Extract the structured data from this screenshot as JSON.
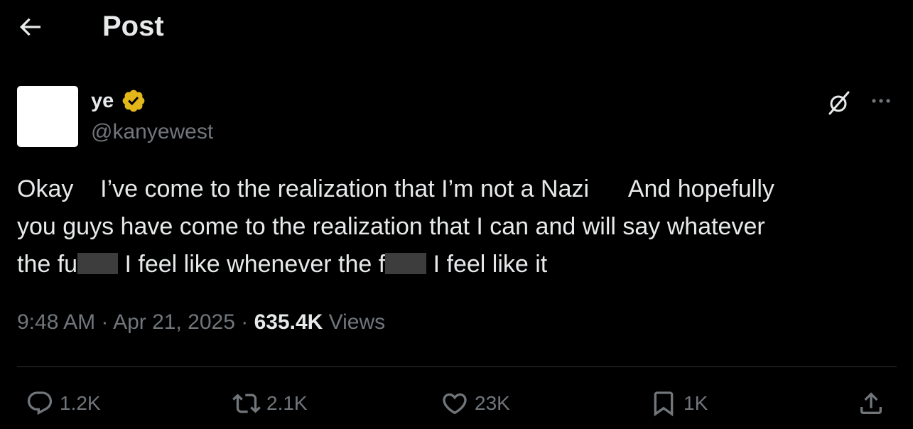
{
  "header": {
    "title": "Post"
  },
  "author": {
    "display_name": "ye",
    "handle": "@kanyewest",
    "verified": true
  },
  "post": {
    "line1": "Okay    I’ve come to the realization that I’m not a Nazi      And hopefully",
    "line2": "you guys have come to the realization that I can and will say whatever",
    "line3a": "the fu",
    "line3b": " I feel like whenever the f",
    "line3c": " I feel like it"
  },
  "meta": {
    "time": "9:48 AM",
    "sep1": " · ",
    "date": "Apr 21, 2025",
    "sep2": " · ",
    "views_count": "635.4K",
    "views_label": " Views"
  },
  "actions": {
    "replies": "1.2K",
    "reposts": "2.1K",
    "likes": "23K",
    "bookmarks": "1K"
  },
  "colors": {
    "background": "#000000",
    "text": "#e7e9ea",
    "muted": "#71767b",
    "verified_gold": "#e2b719",
    "divider": "#2f3336"
  }
}
